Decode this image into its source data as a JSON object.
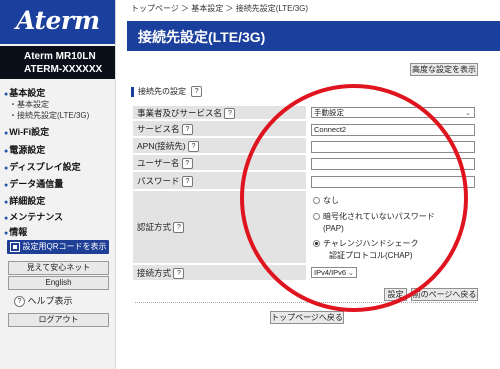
{
  "sidebar": {
    "logo": "Aterm",
    "model_line1": "Aterm   MR10LN",
    "model_line2": "ATERM-XXXXXX",
    "nav": {
      "basic": "基本設定",
      "basic_sub1": "・基本設定",
      "basic_sub2": "・接続先設定(LTE/3G)",
      "wifi": "Wi-Fi設定",
      "power": "電源設定",
      "display": "ディスプレイ設定",
      "data": "データ通信量",
      "detail": "詳細設定",
      "maintenance": "メンテナンス",
      "info": "情報"
    },
    "qr_button": "設定用QRコードを表示",
    "safety_button": "見えて安心ネット",
    "english_button": "English",
    "help_label": "ヘルプ表示",
    "logout_button": "ログアウト"
  },
  "header": {
    "breadcrumb": "トップページ ＞ 基本設定 ＞ 接続先設定(LTE/3G)",
    "title": "接続先設定(LTE/3G)",
    "advanced_button": "高度な設定を表示"
  },
  "form": {
    "section_title": "接続先の設定",
    "help_mark": "?",
    "rows": {
      "provider_label": "事業者及びサービス名",
      "provider_value": "手動設定",
      "service_label": "サービス名",
      "service_value": "Connect2",
      "apn_label": "APN(接続先)",
      "apn_value": "",
      "user_label": "ユーザー名",
      "user_value": "",
      "password_label": "パスワード",
      "password_value": "",
      "auth_label": "認証方式",
      "auth_options": [
        "なし",
        "暗号化されていないパスワード",
        "(PAP)",
        "チャレンジハンドシェーク",
        "認証プロトコル(CHAP)"
      ],
      "conn_label": "接続方式",
      "conn_value": "IPv4/IPv6"
    },
    "set_button": "設定",
    "back_button": "前のページへ戻る",
    "top_button": "トップページへ戻る"
  },
  "colors": {
    "brand": "#1a3f9c",
    "highlight_circle": "#e0141e"
  }
}
